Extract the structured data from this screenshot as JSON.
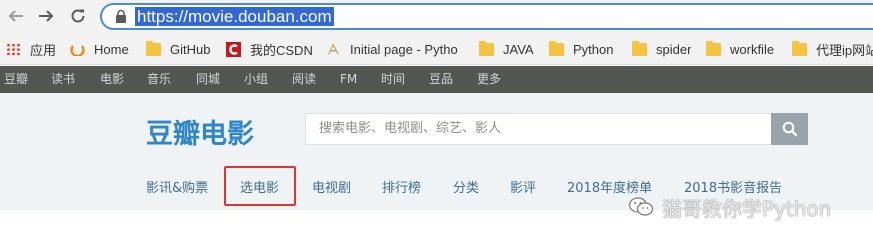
{
  "browser": {
    "url": "https://movie.douban.com",
    "bookmarks": [
      {
        "label": "应用",
        "icon": "apps-icon"
      },
      {
        "label": "Home",
        "icon": "home-favicon"
      },
      {
        "label": "GitHub",
        "icon": "folder-icon"
      },
      {
        "label": "我的CSDN",
        "icon": "csdn-favicon"
      },
      {
        "label": "Initial page - Pytho",
        "icon": "page-favicon"
      },
      {
        "label": "JAVA",
        "icon": "folder-icon"
      },
      {
        "label": "Python",
        "icon": "folder-icon"
      },
      {
        "label": "spider",
        "icon": "folder-icon"
      },
      {
        "label": "workfile",
        "icon": "folder-icon"
      },
      {
        "label": "代理ip网站",
        "icon": "folder-icon"
      }
    ]
  },
  "douban_nav": [
    "豆瓣",
    "读书",
    "电影",
    "音乐",
    "同城",
    "小组",
    "阅读",
    "FM",
    "时间",
    "豆品",
    "更多"
  ],
  "header": {
    "logo": "豆瓣电影",
    "search_placeholder": "搜索电影、电视剧、综艺、影人"
  },
  "subnav": {
    "items": [
      "影讯&购票",
      "选电影",
      "电视剧",
      "排行榜",
      "分类",
      "影评",
      "2018年度榜单",
      "2018书影音报告"
    ],
    "highlighted_index": 1,
    "highlight_color": "#e03431"
  },
  "watermark": {
    "text": "猫哥教你学Python"
  },
  "colors": {
    "nav_bg": "#545652",
    "logo": "#2f87c8",
    "link": "#3f6d8c",
    "header_bg": "#f0f3f5"
  }
}
